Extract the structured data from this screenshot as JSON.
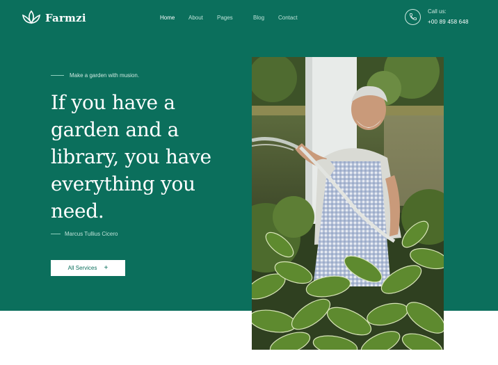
{
  "brand": {
    "name": "Farmzi"
  },
  "nav": {
    "items": [
      {
        "label": "Home",
        "active": true
      },
      {
        "label": "About",
        "active": false
      },
      {
        "label": "Pages",
        "active": false
      },
      {
        "label": "Blog",
        "active": false
      },
      {
        "label": "Contact",
        "active": false
      }
    ]
  },
  "contact": {
    "label": "Call us:",
    "phone": "+00 89 458 648",
    "icon": "phone-icon"
  },
  "hero": {
    "tagline": "Make a garden with musion.",
    "headline": [
      "If you have a",
      "garden and a",
      "library, you have",
      "everything you",
      "need."
    ],
    "author": "Marcus Tullius Cicero",
    "cta_label": "All Services",
    "cta_icon": "+",
    "image": "gardener-watering-plants-photo"
  },
  "colors": {
    "primary": "#0b6f5c",
    "text_light": "#ffffff",
    "muted": "#bfe3d9"
  }
}
